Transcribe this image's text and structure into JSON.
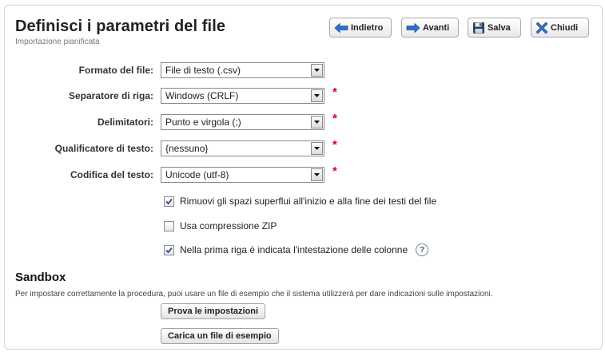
{
  "header": {
    "title": "Definisci i parametri del file",
    "subtitle": "Importazione pianificata"
  },
  "toolbar": {
    "back_label": "Indietro",
    "next_label": "Avanti",
    "save_label": "Salva",
    "close_label": "Chiudi"
  },
  "form": {
    "file_format": {
      "label": "Formato del file:",
      "value": "File di testo (.csv)",
      "required": false
    },
    "row_separator": {
      "label": "Separatore di riga:",
      "value": "Windows (CRLF)",
      "required": true
    },
    "delimiters": {
      "label": "Delimitatori:",
      "value": "Punto e virgola (;)",
      "required": true
    },
    "text_qualifier": {
      "label": "Qualificatore di testo:",
      "value": "{nessuno}",
      "required": true
    },
    "text_encoding": {
      "label": "Codifica del testo:",
      "value": "Unicode (utf-8)",
      "required": true
    },
    "required_marker": "*"
  },
  "options": {
    "trim_spaces": {
      "label": "Rimuovi gli spazi superflui all'inizio e alla fine dei testi del file",
      "checked": true
    },
    "zip": {
      "label": "Usa compressione ZIP",
      "checked": false
    },
    "header_row": {
      "label": "Nella prima riga è indicata l'intestazione delle colonne",
      "checked": true
    },
    "help_glyph": "?"
  },
  "sandbox": {
    "title": "Sandbox",
    "description": "Per impostare correttamente la procedura, puoi usare un file di esempio che il sistema utilizzerà per dare indicazioni sulle impostazioni.",
    "test_button": "Prova le impostazioni",
    "upload_button": "Carica un file di esempio"
  },
  "colors": {
    "required": "#d6001c",
    "icon_blue": "#2f6fd1",
    "close_blue": "#3a6fc4"
  },
  "icons": {
    "back": "arrow-left-icon",
    "next": "arrow-right-icon",
    "save": "floppy-disk-icon",
    "close": "close-x-icon",
    "dropdown": "chevron-down-icon",
    "check": "checkmark-icon",
    "help": "help-circle-icon"
  }
}
